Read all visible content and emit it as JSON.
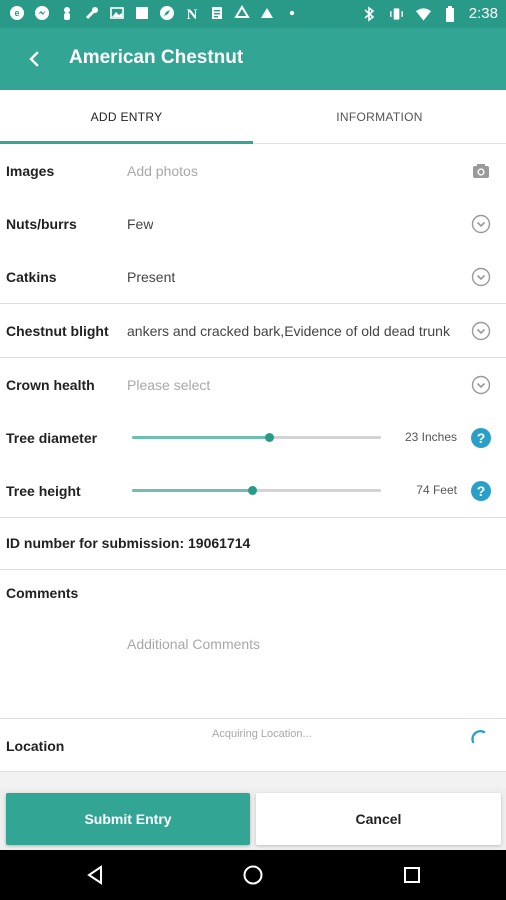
{
  "status_bar": {
    "time": "2:38",
    "left_icons": [
      "notification-icon",
      "messenger-icon",
      "person-icon",
      "wrench-icon",
      "image-icon",
      "square-icon",
      "compass-icon",
      "n-icon",
      "doc-icon",
      "drive-icon",
      "triangle-icon",
      "overflow-dot-icon"
    ],
    "right_icons": [
      "bluetooth-icon",
      "vibrate-icon",
      "wifi-icon",
      "battery-icon"
    ]
  },
  "app_bar": {
    "title": "American Chestnut"
  },
  "tabs": [
    {
      "label": "ADD ENTRY",
      "active": true
    },
    {
      "label": "INFORMATION",
      "active": false
    }
  ],
  "form": {
    "images": {
      "label": "Images",
      "placeholder": "Add photos"
    },
    "nuts_burrs": {
      "label": "Nuts/burrs",
      "value": "Few"
    },
    "catkins": {
      "label": "Catkins",
      "value": "Present"
    },
    "chestnut_blight": {
      "label": "Chestnut blight",
      "value": "ankers and cracked bark,Evidence of old dead trunk"
    },
    "crown_health": {
      "label": "Crown health",
      "placeholder": "Please select"
    },
    "tree_diameter": {
      "label": "Tree diameter",
      "value_text": "23 Inches",
      "fraction": 0.55
    },
    "tree_height": {
      "label": "Tree height",
      "value_text": "74 Feet",
      "fraction": 0.48
    },
    "id_text": "ID number for submission: 19061714",
    "comments": {
      "label": "Comments",
      "placeholder": "Additional Comments"
    },
    "location": {
      "label": "Location",
      "status": "Acquiring Location..."
    }
  },
  "actions": {
    "submit": "Submit Entry",
    "cancel": "Cancel"
  },
  "colors": {
    "primary": "#33a594",
    "status": "#2a9a88",
    "help": "#2aa0c8"
  }
}
